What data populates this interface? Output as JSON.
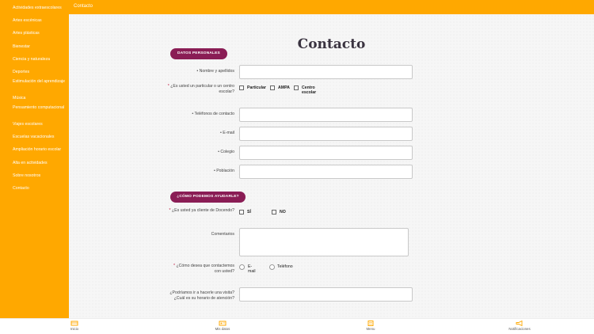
{
  "header": {
    "breadcrumb": "Contacto"
  },
  "sidebar": {
    "items": [
      {
        "label": "Actividades extraescolares"
      },
      {
        "label": "Artes escénicas"
      },
      {
        "label": "Artes plásticas"
      },
      {
        "label": "Bienestar"
      },
      {
        "label": "Ciencia y naturaleza"
      },
      {
        "label": "Deportes"
      },
      {
        "label": "Estimulación del aprendizaje"
      },
      {
        "label": "Música"
      },
      {
        "label": "Pensamiento computacional"
      },
      {
        "label": "Viajes escolares"
      },
      {
        "label": "Escuelas vacacionales"
      },
      {
        "label": "Ampliación horario escolar"
      },
      {
        "label": "Alta en actividades"
      },
      {
        "label": "Sobre nosotros"
      },
      {
        "label": "Contacto"
      }
    ]
  },
  "page": {
    "title": "Contacto"
  },
  "section1": {
    "pill": "DATOS PERSONALES",
    "name_label": "• Nombre y apellidos",
    "who_label": "¿Es usted un particular o un centro escolar?",
    "who_options": [
      "Particular",
      "AMPA",
      "Centro escolar"
    ],
    "phone_label": "• Teléfonos de contacto",
    "email_label": "• E-mail",
    "school_label": "• Colegio",
    "town_label": "• Población"
  },
  "section2": {
    "pill": "¿CÓMO PODEMOS AYUDARLE?",
    "client_label": "¿Es usted ya cliente de Docendo?",
    "client_options": [
      "SÍ",
      "NO"
    ],
    "comments_label": "Comentarios",
    "contact_label": "¿Cómo desea que contactemos con usted?",
    "contact_options": [
      "E-mail",
      "Teléfono"
    ],
    "visit_label": "¿Podríamos ir a hacerle una visita? ¿Cuál es su horario de atención?"
  },
  "required_mark": "*",
  "bottom_nav": [
    {
      "label": "Inicio",
      "icon": "home-icon"
    },
    {
      "label": "Mis datos",
      "icon": "profile-icon"
    },
    {
      "label": "Menu",
      "icon": "menu-icon"
    },
    {
      "label": "Notificaciones",
      "icon": "megaphone-icon"
    }
  ],
  "colors": {
    "accent": "#ffa800",
    "pill": "#8a1d55",
    "required": "#c0143c"
  }
}
